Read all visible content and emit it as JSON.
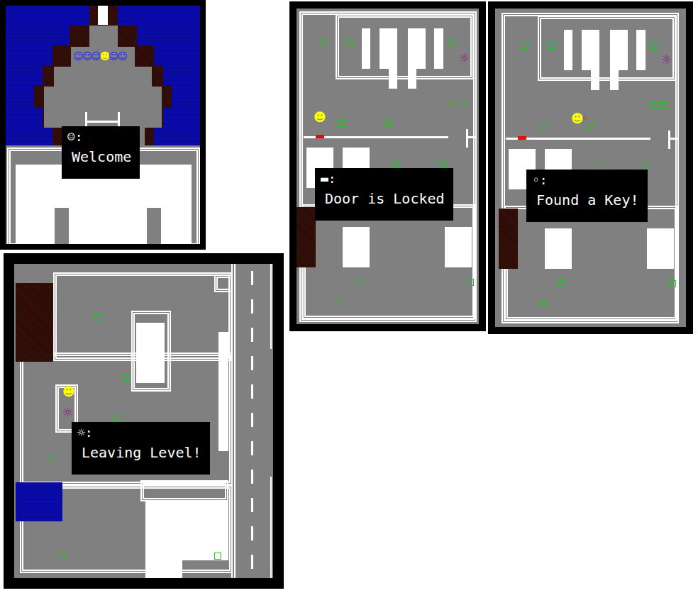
{
  "panels": [
    {
      "kind": "arena",
      "party": [
        {
          "glyph": "☺",
          "color": "#1a1aff"
        },
        {
          "glyph": "☺",
          "color": "#1a1aff"
        },
        {
          "glyph": "☺",
          "color": "#1a1aff"
        },
        {
          "glyph": "☻",
          "color": "#ffff00"
        },
        {
          "glyph": "☺",
          "color": "#1a1aff"
        },
        {
          "glyph": "☺",
          "color": "#1a1aff"
        }
      ],
      "dialog": {
        "speaker": "☺:",
        "message": "Welcome"
      }
    },
    {
      "kind": "street",
      "player": "☻",
      "exit": "☼",
      "dialog": {
        "speaker": "☼:",
        "message": "Leaving Level!"
      }
    },
    {
      "kind": "house",
      "player": "☻",
      "exit": "☼",
      "dialog": {
        "speaker": "▬:",
        "message": "Door is Locked"
      }
    },
    {
      "kind": "house",
      "player": "☻",
      "exit": "☼",
      "key": "◦",
      "dialog": {
        "speaker": "◦:",
        "message": "Found a Key!"
      }
    }
  ]
}
